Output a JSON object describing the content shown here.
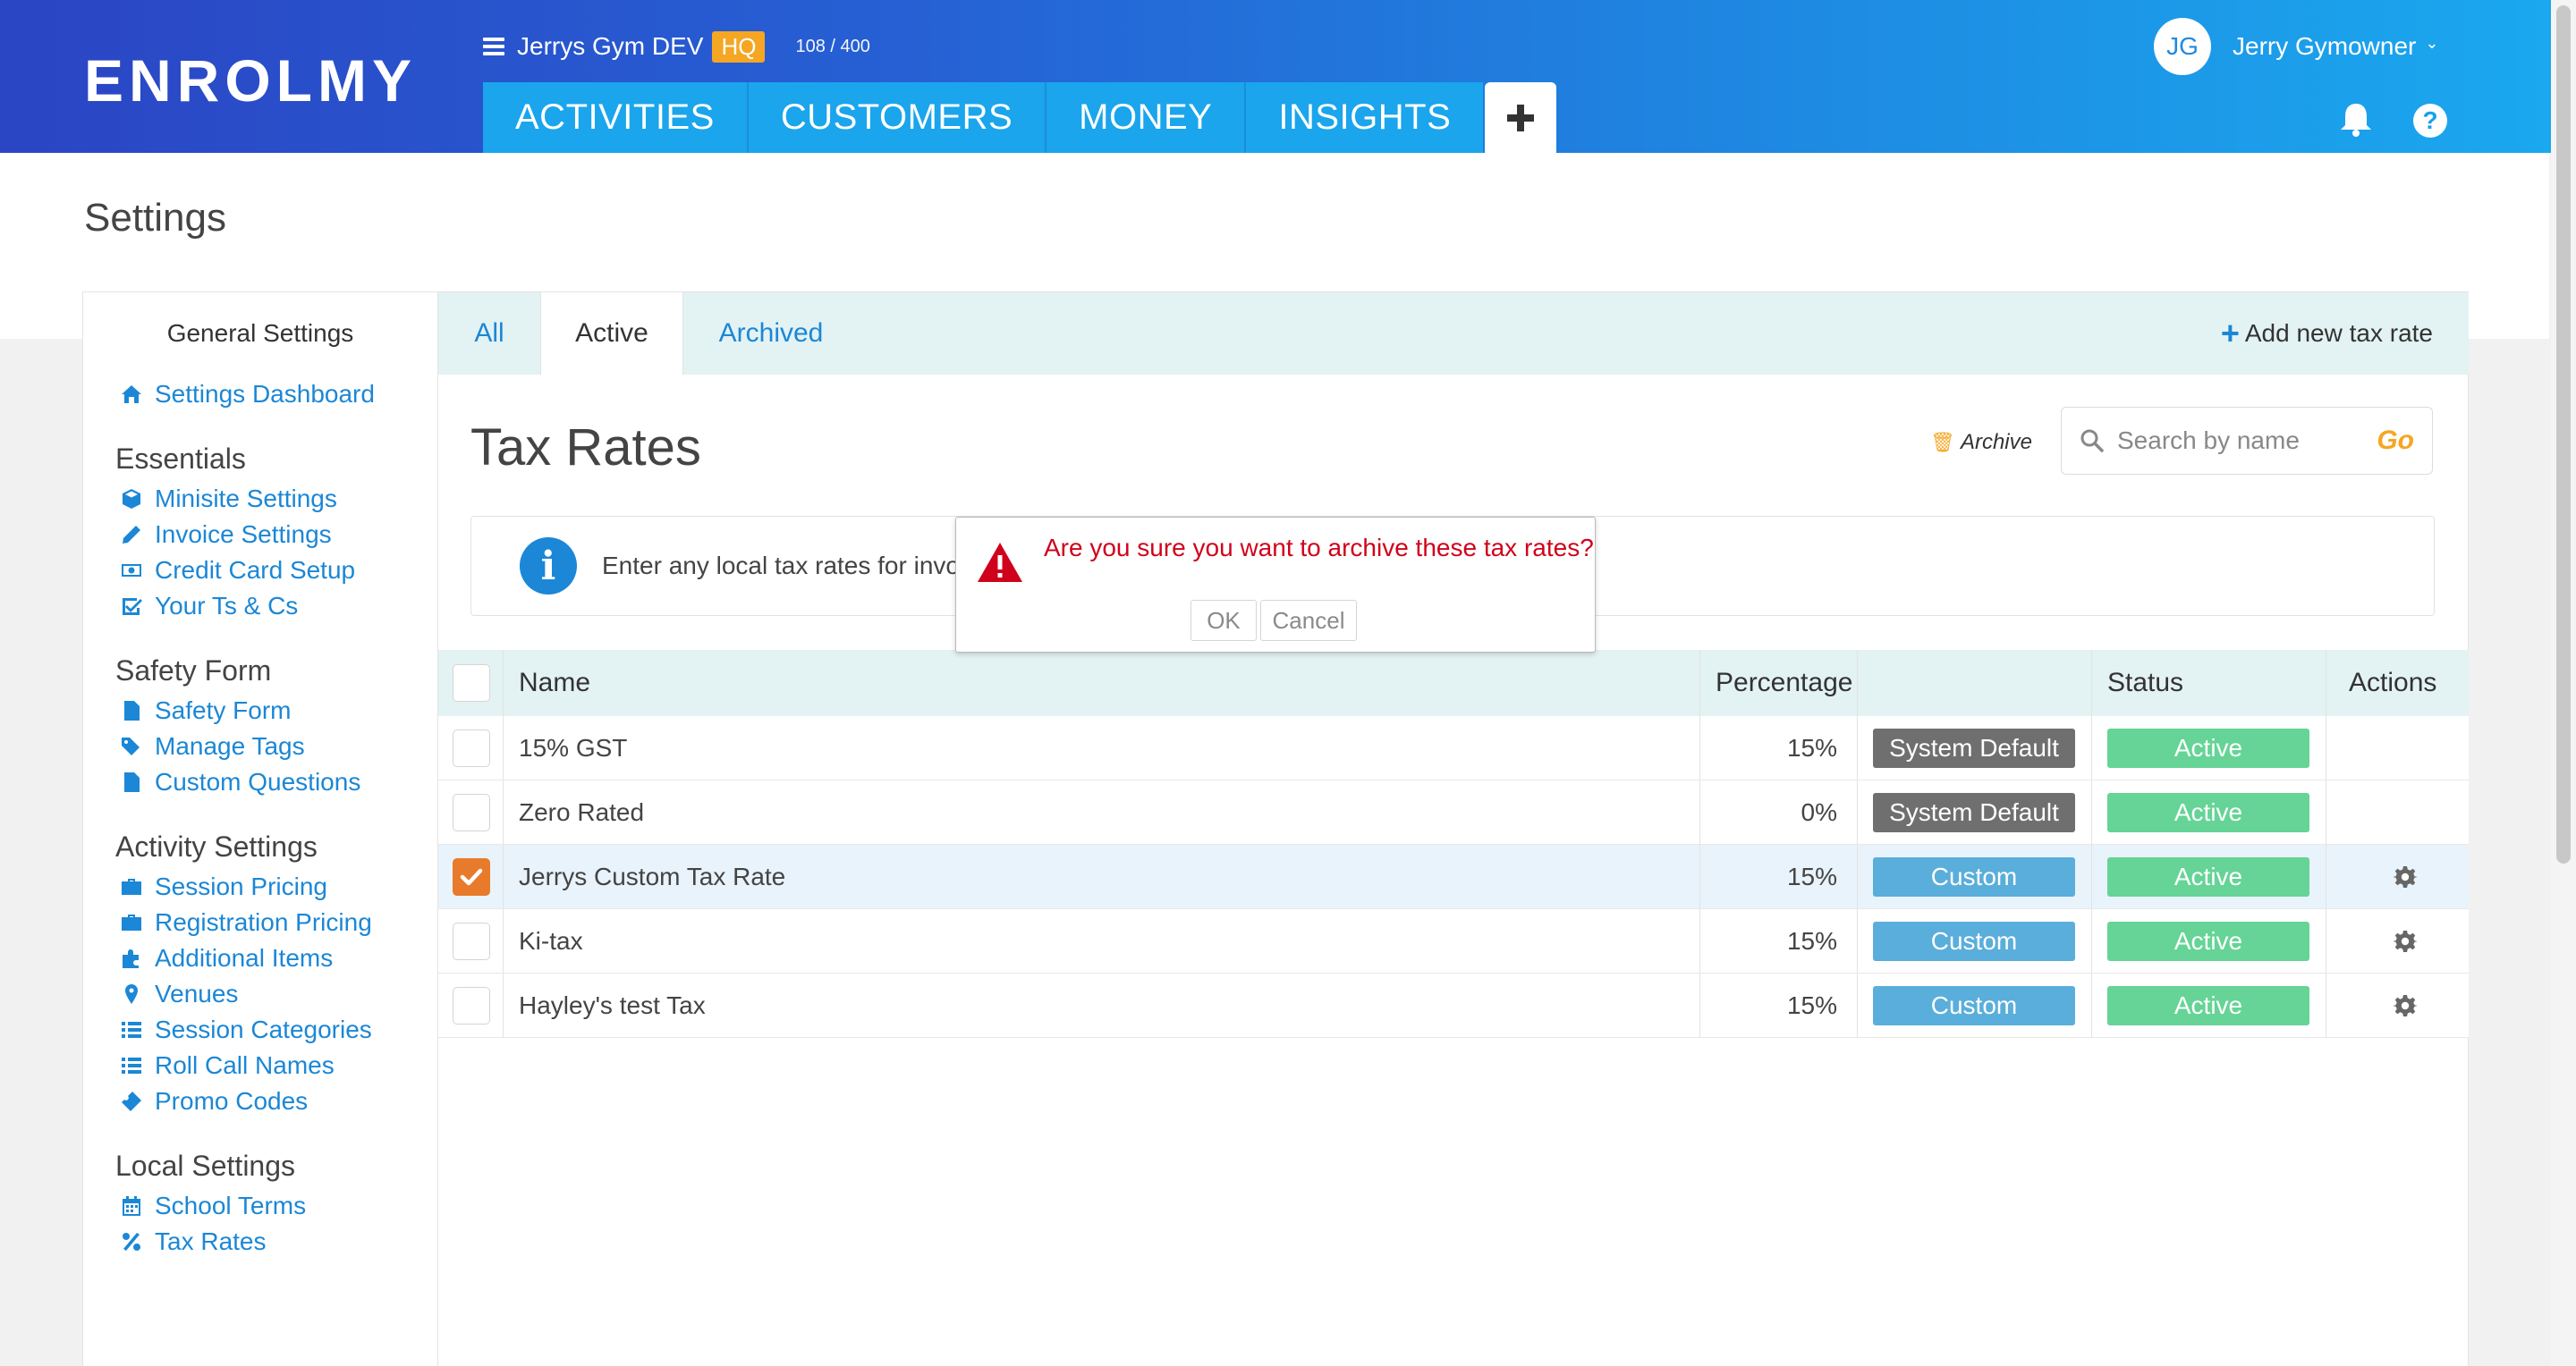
{
  "header": {
    "logo": "ENROLMY",
    "org_name": "Jerrys Gym DEV",
    "org_badge": "HQ",
    "org_count": "108 / 400",
    "nav": [
      "ACTIVITIES",
      "CUSTOMERS",
      "MONEY",
      "INSIGHTS"
    ],
    "user_initials": "JG",
    "user_name": "Jerry Gymowner",
    "help_glyph": "?"
  },
  "page": {
    "title": "Settings"
  },
  "sidebar": {
    "title": "General Settings",
    "dashboard": "Settings Dashboard",
    "sections": [
      {
        "title": "Essentials",
        "items": [
          "Minisite Settings",
          "Invoice Settings",
          "Credit Card Setup",
          "Your Ts & Cs"
        ]
      },
      {
        "title": "Safety Form",
        "items": [
          "Safety Form",
          "Manage Tags",
          "Custom Questions"
        ]
      },
      {
        "title": "Activity Settings",
        "items": [
          "Session Pricing",
          "Registration Pricing",
          "Additional Items",
          "Venues",
          "Session Categories",
          "Roll Call Names",
          "Promo Codes"
        ]
      },
      {
        "title": "Local Settings",
        "items": [
          "School Terms",
          "Tax Rates"
        ]
      }
    ]
  },
  "content": {
    "tabs": [
      "All",
      "Active",
      "Archived"
    ],
    "active_tab": "Active",
    "add_new": "Add new tax rate",
    "title": "Tax Rates",
    "archive_label": "Archive",
    "search_placeholder": "Search by name",
    "search_go": "Go",
    "info_text": "Enter any local tax rates for invoic",
    "columns": {
      "name": "Name",
      "percentage": "Percentage",
      "type": "",
      "status": "Status",
      "actions": "Actions"
    },
    "rows": [
      {
        "name": "15% GST",
        "percentage": "15%",
        "type": "System Default",
        "status": "Active",
        "checked": false,
        "has_action": false
      },
      {
        "name": "Zero Rated",
        "percentage": "0%",
        "type": "System Default",
        "status": "Active",
        "checked": false,
        "has_action": false
      },
      {
        "name": "Jerrys Custom Tax Rate",
        "percentage": "15%",
        "type": "Custom",
        "status": "Active",
        "checked": true,
        "has_action": true
      },
      {
        "name": "Ki-tax",
        "percentage": "15%",
        "type": "Custom",
        "status": "Active",
        "checked": false,
        "has_action": true
      },
      {
        "name": "Hayley's test Tax",
        "percentage": "15%",
        "type": "Custom",
        "status": "Active",
        "checked": false,
        "has_action": true
      }
    ]
  },
  "dialog": {
    "message": "Are you sure you want to archive these tax rates?",
    "ok": "OK",
    "cancel": "Cancel"
  },
  "colors": {
    "brand_blue": "#1b87d6",
    "accent_orange": "#f5a623",
    "checkbox_orange": "#e87a2b",
    "status_active": "#65d496",
    "type_custom": "#5aaedb",
    "type_system": "#6f6f6f",
    "error_red": "#d0021b"
  }
}
